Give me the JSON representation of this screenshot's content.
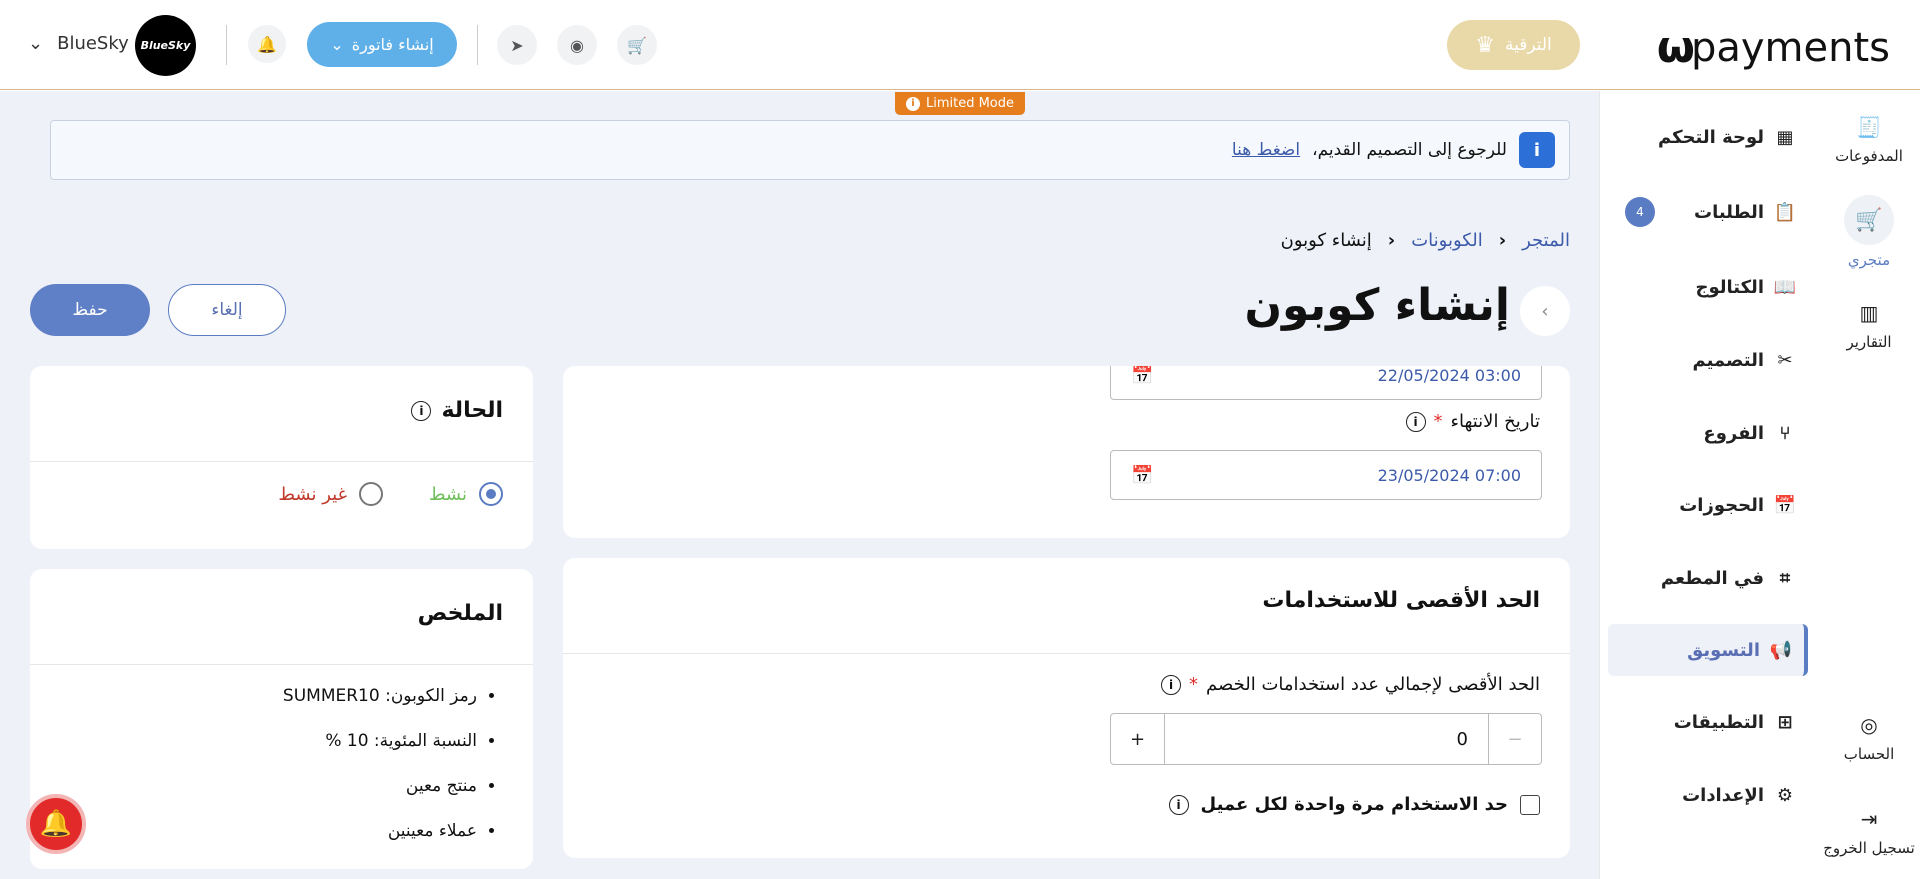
{
  "header": {
    "logo_mark": "ω",
    "logo_word": "payments",
    "upgrade_label": "الترقية",
    "create_invoice_label": "إنشاء فاتورة",
    "account_name": "BlueSky",
    "avatar_text": "BlueSky"
  },
  "limited_mode": "Limited Mode",
  "banner": {
    "text": "للرجوع إلى التصميم القديم،",
    "link": "اضغط هنا"
  },
  "icon_rail": {
    "payments": "المدفوعات",
    "my_store": "متجري",
    "reports": "التقارير",
    "account": "الحساب",
    "logout": "تسجيل الخروج"
  },
  "side_nav": {
    "items": [
      {
        "label": "لوحة التحكم",
        "icon": "grid-icon"
      },
      {
        "label": "الطلبات",
        "icon": "clipboard-icon",
        "badge": "4"
      },
      {
        "label": "الكتالوج",
        "icon": "book-icon"
      },
      {
        "label": "التصميم",
        "icon": "design-tools-icon"
      },
      {
        "label": "الفروع",
        "icon": "branch-icon"
      },
      {
        "label": "الحجوزات",
        "icon": "calendar-icon"
      },
      {
        "label": "في المطعم",
        "icon": "qr-icon"
      },
      {
        "label": "التسويق",
        "icon": "megaphone-icon",
        "active": true
      },
      {
        "label": "التطبيقات",
        "icon": "apps-icon"
      },
      {
        "label": "الإعدادات",
        "icon": "settings-icon"
      }
    ]
  },
  "breadcrumb": {
    "store": "المتجر",
    "coupons": "الكوبونات",
    "current": "إنشاء كوبون"
  },
  "page": {
    "title": "إنشاء كوبون",
    "cancel_label": "إلغاء",
    "save_label": "حفظ"
  },
  "dates": {
    "start_value": "22/05/2024 03:00",
    "end_label": "تاريخ الانتهاء",
    "end_value": "23/05/2024 07:00"
  },
  "usage_limit": {
    "title": "الحد الأقصى للاستخدامات",
    "total_label": "الحد الأقصى لإجمالي عدد استخدامات الخصم",
    "total_value": "0",
    "plus": "+",
    "once_per_customer_label": "حد الاستخدام مرة واحدة لكل عميل"
  },
  "status": {
    "title": "الحالة",
    "active_label": "نشط",
    "inactive_label": "غير نشط",
    "selected": "active",
    "active_color": "#6fbf5a",
    "inactive_color": "#c0392b"
  },
  "summary": {
    "title": "الملخص",
    "items": [
      "رمز الكوبون: SUMMER10",
      "النسبة المئوية: 10 %",
      "منتج معين",
      "عملاء معينين"
    ]
  },
  "colors": {
    "accent": "#5a7cc2",
    "invoice_button": "#5fb0e8",
    "limited_mode": "#e67e1e",
    "upgrade": "#ead9a8"
  }
}
